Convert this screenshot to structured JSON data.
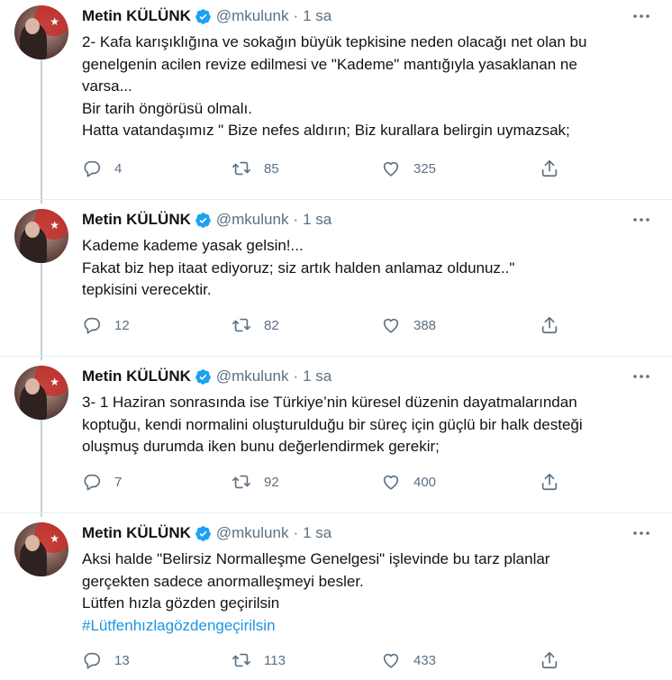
{
  "tweets": [
    {
      "name": "Metin KÜLÜNK",
      "handle": "@mkulunk",
      "dot": "·",
      "time": "1 sa",
      "lines": [
        "2- Kafa karışıklığına ve sokağın büyük tepkisine neden olacağı net olan bu",
        "genelgenin acilen revize edilmesi ve \"Kademe\" mantığıyla yasaklanan ne",
        "varsa...",
        "Bir tarih öngörüsü olmalı.",
        "Hatta vatandaşımız \" Bize nefes aldırın; Biz kurallara belirgin uymazsak;"
      ],
      "replies": "4",
      "retweets": "85",
      "likes": "325"
    },
    {
      "name": "Metin KÜLÜNK",
      "handle": "@mkulunk",
      "dot": "·",
      "time": "1 sa",
      "lines": [
        "Kademe kademe yasak gelsin!...",
        "Fakat biz hep itaat ediyoruz; siz artık halden anlamaz oldunuz..\"",
        "tepkisini verecektir."
      ],
      "replies": "12",
      "retweets": "82",
      "likes": "388"
    },
    {
      "name": "Metin KÜLÜNK",
      "handle": "@mkulunk",
      "dot": "·",
      "time": "1 sa",
      "lines": [
        "3- 1 Haziran sonrasında ise Türkiye’nin küresel düzenin dayatmalarından",
        "koptuğu, kendi normalini oluşturulduğu bir süreç için güçlü bir halk desteği",
        "oluşmuş durumda iken bunu değerlendirmek gerekir;"
      ],
      "replies": "7",
      "retweets": "92",
      "likes": "400"
    },
    {
      "name": "Metin KÜLÜNK",
      "handle": "@mkulunk",
      "dot": "·",
      "time": "1 sa",
      "lines": [
        "Aksi halde \"Belirsiz Normalleşme Genelgesi\" işlevinde bu tarz planlar",
        "gerçekten sadece anormalleşmeyi besler.",
        "Lütfen hızla gözden geçirilsin"
      ],
      "hashtag": "#Lütfenhızlagözdengeçirilsin",
      "replies": "13",
      "retweets": "113",
      "likes": "433"
    }
  ],
  "icons": {
    "verified": "verified-badge-icon",
    "more": "more-horizontal-icon",
    "reply": "reply-icon",
    "retweet": "retweet-icon",
    "like": "heart-icon",
    "share": "share-icon"
  },
  "colors": {
    "accent": "#1da1f2",
    "hashtag": "#1b95e0",
    "muted": "#5b7083",
    "divider": "#e6ecf0",
    "thread_line": "#c4cfd6"
  }
}
